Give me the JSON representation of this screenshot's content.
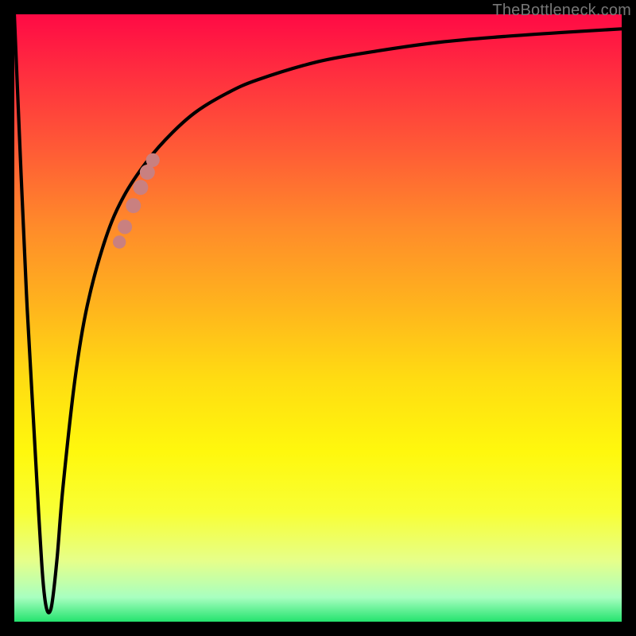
{
  "watermark": "TheBottleneck.com",
  "colors": {
    "background": "#000000",
    "curve": "#000000",
    "marker_fill": "#c98080",
    "gradient_top": "#ff0a45",
    "gradient_bottom": "#24e36e"
  },
  "chart_data": {
    "type": "line",
    "title": "",
    "xlabel": "",
    "ylabel": "",
    "x_range": [
      0,
      100
    ],
    "y_range": [
      0,
      100
    ],
    "grid": false,
    "legend": false,
    "series": [
      {
        "name": "bottleneck-curve",
        "x": [
          0,
          2,
          4,
          5,
          6,
          7,
          8,
          10,
          12,
          15,
          18,
          22,
          26,
          30,
          35,
          40,
          50,
          60,
          70,
          80,
          90,
          100
        ],
        "y": [
          100,
          54,
          18,
          4,
          2,
          10,
          22,
          40,
          52,
          63,
          70,
          76,
          80.5,
          84,
          87,
          89.2,
          92.2,
          94,
          95.4,
          96.3,
          97,
          97.6
        ]
      }
    ],
    "markers": [
      {
        "name": "dot-1",
        "x": 17.3,
        "y": 62.5,
        "r": 1.0
      },
      {
        "name": "dot-2",
        "x": 18.2,
        "y": 65.0,
        "r": 1.2
      },
      {
        "name": "dot-3",
        "x": 19.6,
        "y": 68.5,
        "r": 1.3
      },
      {
        "name": "dot-4",
        "x": 20.8,
        "y": 71.5,
        "r": 1.3
      },
      {
        "name": "dot-5",
        "x": 21.9,
        "y": 74.0,
        "r": 1.3
      },
      {
        "name": "dot-6",
        "x": 22.8,
        "y": 76.0,
        "r": 1.1
      }
    ]
  }
}
